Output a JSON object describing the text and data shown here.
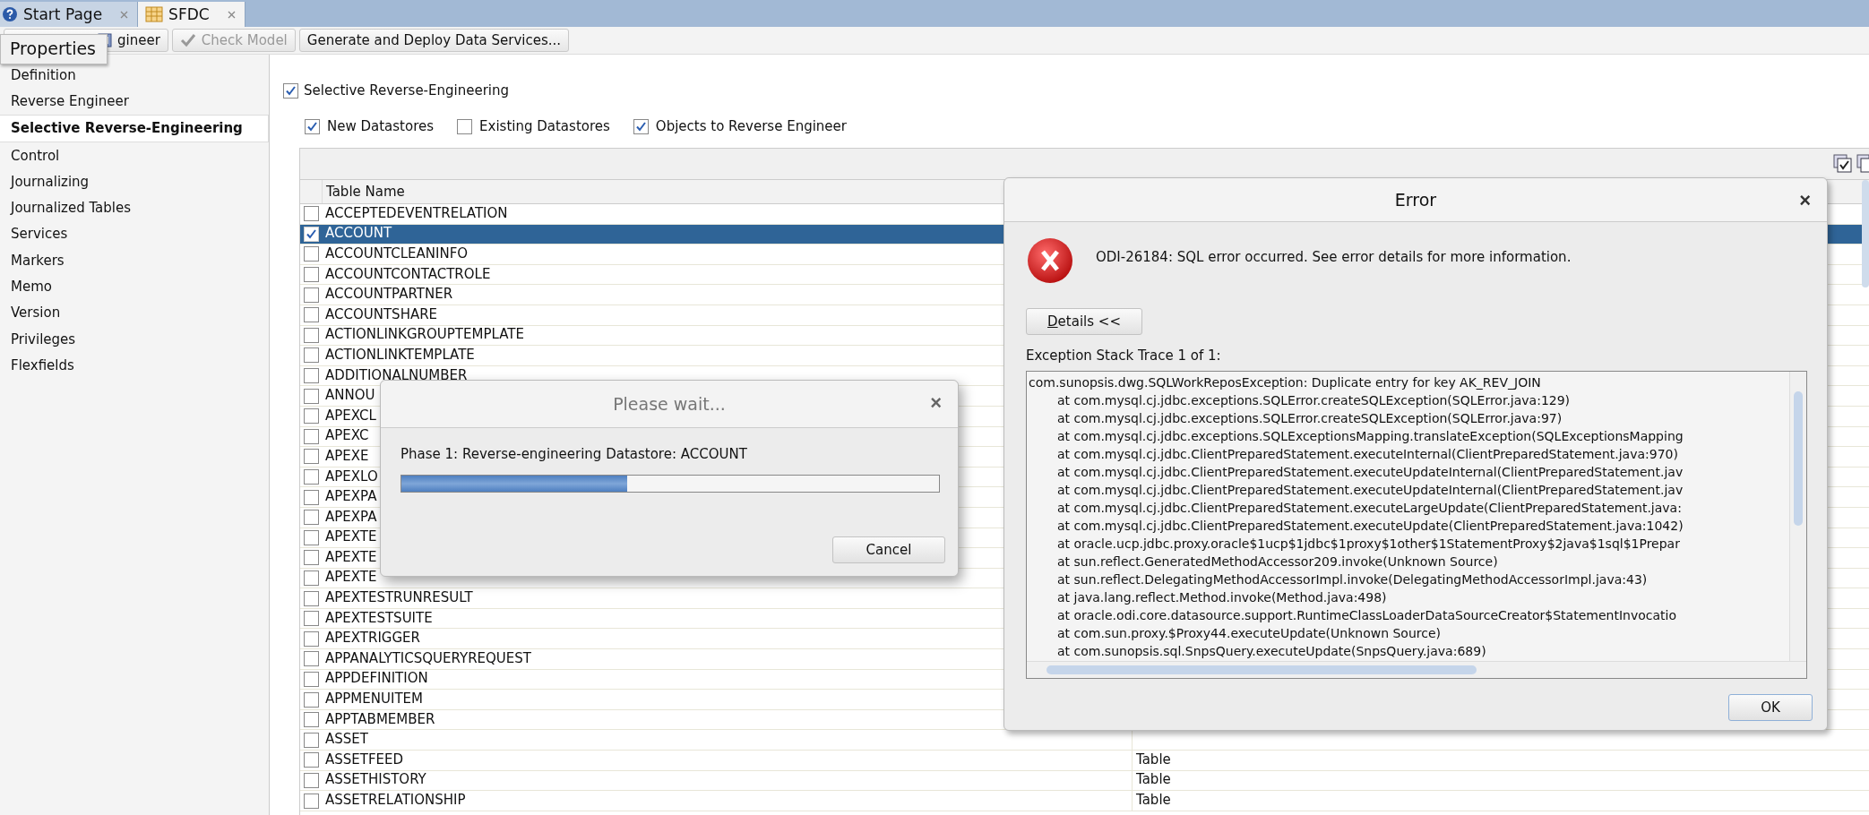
{
  "tabs": [
    {
      "label": "Start Page",
      "kind": "help",
      "selected": false
    },
    {
      "label": "SFDC",
      "kind": "model",
      "selected": true
    }
  ],
  "toolbar": {
    "buttons": [
      {
        "label": "gineer",
        "kind": "reverse",
        "disabled": false
      },
      {
        "label": "Check Model",
        "kind": "check",
        "disabled": true
      },
      {
        "label": "Generate and Deploy Data Services...",
        "kind": "plain",
        "disabled": false
      }
    ]
  },
  "tooltip": {
    "text": "Properties"
  },
  "sidebar": {
    "items": [
      {
        "label": "Definition",
        "selected": false
      },
      {
        "label": "Reverse Engineer",
        "selected": false
      },
      {
        "label": "Selective Reverse-Engineering",
        "selected": true
      },
      {
        "label": "Control",
        "selected": false
      },
      {
        "label": "Journalizing",
        "selected": false
      },
      {
        "label": "Journalized Tables",
        "selected": false
      },
      {
        "label": "Services",
        "selected": false
      },
      {
        "label": "Markers",
        "selected": false
      },
      {
        "label": "Memo",
        "selected": false
      },
      {
        "label": "Version",
        "selected": false
      },
      {
        "label": "Privileges",
        "selected": false
      },
      {
        "label": "Flexfields",
        "selected": false
      }
    ]
  },
  "selective": {
    "label": "Selective Reverse-Engineering",
    "checked": true
  },
  "options": [
    {
      "label": "New Datastores",
      "checked": true
    },
    {
      "label": "Existing Datastores",
      "checked": false
    },
    {
      "label": "Objects to Reverse Engineer",
      "checked": true
    }
  ],
  "table": {
    "columns": [
      "Table Name"
    ],
    "rows": [
      {
        "name": "ACCEPTEDEVENTRELATION",
        "checked": false,
        "selected": false
      },
      {
        "name": "ACCOUNT",
        "checked": true,
        "selected": true
      },
      {
        "name": "ACCOUNTCLEANINFO",
        "checked": false,
        "selected": false
      },
      {
        "name": "ACCOUNTCONTACTROLE",
        "checked": false,
        "selected": false
      },
      {
        "name": "ACCOUNTPARTNER",
        "checked": false,
        "selected": false
      },
      {
        "name": "ACCOUNTSHARE",
        "checked": false,
        "selected": false
      },
      {
        "name": "ACTIONLINKGROUPTEMPLATE",
        "checked": false,
        "selected": false
      },
      {
        "name": "ACTIONLINKTEMPLATE",
        "checked": false,
        "selected": false
      },
      {
        "name": "ADDITIONALNUMBER",
        "checked": false,
        "selected": false
      },
      {
        "name": "ANNOU",
        "checked": false,
        "selected": false
      },
      {
        "name": "APEXCL",
        "checked": false,
        "selected": false
      },
      {
        "name": "APEXC",
        "checked": false,
        "selected": false
      },
      {
        "name": "APEXE",
        "checked": false,
        "selected": false
      },
      {
        "name": "APEXLO",
        "checked": false,
        "selected": false
      },
      {
        "name": "APEXPA",
        "checked": false,
        "selected": false
      },
      {
        "name": "APEXPA",
        "checked": false,
        "selected": false
      },
      {
        "name": "APEXTE",
        "checked": false,
        "selected": false
      },
      {
        "name": "APEXTE",
        "checked": false,
        "selected": false
      },
      {
        "name": "APEXTE",
        "checked": false,
        "selected": false
      },
      {
        "name": "APEXTESTRUNRESULT",
        "checked": false,
        "selected": false
      },
      {
        "name": "APEXTESTSUITE",
        "checked": false,
        "selected": false
      },
      {
        "name": "APEXTRIGGER",
        "checked": false,
        "selected": false
      },
      {
        "name": "APPANALYTICSQUERYREQUEST",
        "checked": false,
        "selected": false
      },
      {
        "name": "APPDEFINITION",
        "checked": false,
        "selected": false
      },
      {
        "name": "APPMENUITEM",
        "checked": false,
        "selected": false
      },
      {
        "name": "APPTABMEMBER",
        "checked": false,
        "selected": false
      },
      {
        "name": "ASSET",
        "checked": false,
        "selected": false
      },
      {
        "name": "ASSETFEED",
        "checked": false,
        "selected": false,
        "column_2": "Table"
      },
      {
        "name": "ASSETHISTORY",
        "checked": false,
        "selected": false,
        "column_2": "Table"
      },
      {
        "name": "ASSETRELATIONSHIP",
        "checked": false,
        "selected": false,
        "column_2": "Table"
      }
    ]
  },
  "wait_dialog": {
    "title": "Please wait...",
    "close": "×",
    "message": "Phase 1: Reverse-engineering Datastore: ACCOUNT",
    "level": 0.42,
    "button": "Cancel"
  },
  "error_dialog": {
    "title": "Error",
    "close": "×",
    "message": "ODI-26184: SQL error occurred. See error details for more information.",
    "details_button": "Details <<",
    "trace_label": "Exception Stack Trace 1 of 1:",
    "trace": [
      {
        "kind": "head",
        "text": "com.sunopsis.dwg.SQLWorkReposException:   Duplicate entry for key AK_REV_JOIN"
      },
      {
        "kind": "frame",
        "text": "at com.mysql.cj.jdbc.exceptions.SQLError.createSQLException(SQLError.java:129)"
      },
      {
        "kind": "frame",
        "text": "at com.mysql.cj.jdbc.exceptions.SQLError.createSQLException(SQLError.java:97)"
      },
      {
        "kind": "frame",
        "text": "at com.mysql.cj.jdbc.exceptions.SQLExceptionsMapping.translateException(SQLExceptionsMapping"
      },
      {
        "kind": "frame",
        "text": "at com.mysql.cj.jdbc.ClientPreparedStatement.executeInternal(ClientPreparedStatement.java:970)"
      },
      {
        "kind": "frame",
        "text": "at com.mysql.cj.jdbc.ClientPreparedStatement.executeUpdateInternal(ClientPreparedStatement.jav"
      },
      {
        "kind": "frame",
        "text": "at com.mysql.cj.jdbc.ClientPreparedStatement.executeUpdateInternal(ClientPreparedStatement.jav"
      },
      {
        "kind": "frame",
        "text": "at com.mysql.cj.jdbc.ClientPreparedStatement.executeLargeUpdate(ClientPreparedStatement.java:"
      },
      {
        "kind": "frame",
        "text": "at com.mysql.cj.jdbc.ClientPreparedStatement.executeUpdate(ClientPreparedStatement.java:1042)"
      },
      {
        "kind": "frame",
        "text": "at oracle.ucp.jdbc.proxy.oracle$1ucp$1jdbc$1proxy$1other$1StatementProxy$2java$1sql$1Prepar"
      },
      {
        "kind": "frame",
        "text": "at sun.reflect.GeneratedMethodAccessor209.invoke(Unknown Source)"
      },
      {
        "kind": "frame",
        "text": "at sun.reflect.DelegatingMethodAccessorImpl.invoke(DelegatingMethodAccessorImpl.java:43)"
      },
      {
        "kind": "frame",
        "text": "at java.lang.reflect.Method.invoke(Method.java:498)"
      },
      {
        "kind": "frame",
        "text": "at oracle.odi.core.datasource.support.RuntimeClassLoaderDataSourceCreator$StatementInvocatio"
      },
      {
        "kind": "frame",
        "text": "at com.sun.proxy.$Proxy44.executeUpdate(Unknown Source)"
      },
      {
        "kind": "frame",
        "text": "at com.sunopsis.sql.SnpsQuery.executeUpdate(SnpsQuery.java:689)"
      }
    ],
    "ok_button": "OK"
  }
}
